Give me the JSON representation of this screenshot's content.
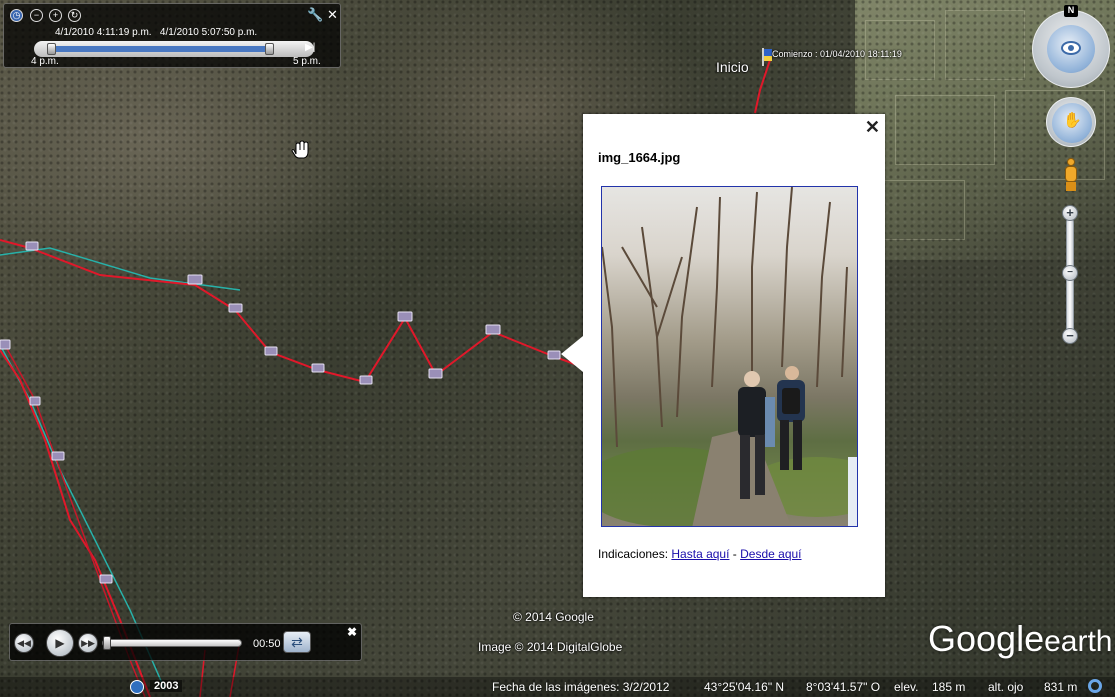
{
  "time_slider": {
    "range_start": "4/1/2010    4:11:19 p.m.",
    "range_end": "4/1/2010    5:07:50 p.m.",
    "tick_start": "4 p.m.",
    "tick_end": "5 p.m.",
    "selected_range": [
      0.06,
      0.84
    ]
  },
  "map": {
    "start_label": "Inicio",
    "start_caption": "Comienzo : 01/04/2010 18:11:19",
    "copyright_google": "© 2014 Google",
    "copyright_image": "Image © 2014 DigitalGlobe"
  },
  "navigation": {
    "north_label": "N",
    "zoom_in": "+",
    "zoom_out": "−"
  },
  "balloon": {
    "title": "img_1664.jpg",
    "directions_label": "Indicaciones:",
    "link_to_here": "Hasta aquí",
    "separator": "-",
    "link_from_here": "Desde aquí",
    "close": "✕"
  },
  "tour_player": {
    "time": "00:50",
    "close": "✖",
    "progress": 0.01
  },
  "status_bar": {
    "year": "2003",
    "imagery_date": "Fecha de las imágenes: 3/2/2012",
    "lat": "43°25'04.16\" N",
    "lon": "8°03'41.57\" O",
    "elev_label": "elev.",
    "elev_value": "185 m",
    "eye_alt_label": "alt. ojo",
    "eye_alt_value": "831 m"
  },
  "logo": {
    "google": "Google",
    "earth": "earth"
  },
  "colors": {
    "track_red": "#e0182a",
    "track_cyan": "#27b1a9",
    "slider_fill": "#4978c2"
  }
}
